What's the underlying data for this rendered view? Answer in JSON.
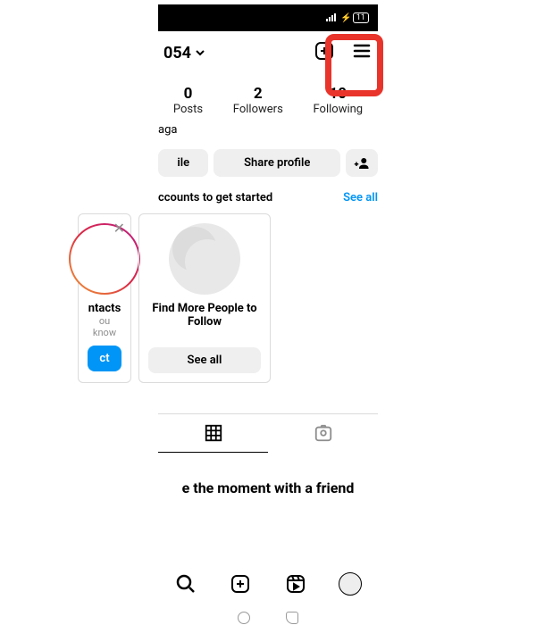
{
  "status": {
    "battery": "11"
  },
  "header": {
    "username_fragment": "054"
  },
  "stats": {
    "posts": {
      "count": "0",
      "label": "Posts"
    },
    "followers": {
      "count": "2",
      "label": "Followers"
    },
    "following": {
      "count": "10",
      "label": "Following"
    }
  },
  "bio": {
    "name_fragment": "aga"
  },
  "actions": {
    "edit_profile_fragment": "ile",
    "share_profile": "Share profile"
  },
  "discover": {
    "title_fragment": "ccounts to get started",
    "see_all": "See all"
  },
  "cards": {
    "contacts": {
      "title_fragment": "ntacts",
      "sub_fragment": "ou know",
      "button_fragment": "ct"
    },
    "findmore": {
      "title": "Find More People to Follow",
      "button": "See all"
    }
  },
  "capture_msg": "e the moment with a friend"
}
